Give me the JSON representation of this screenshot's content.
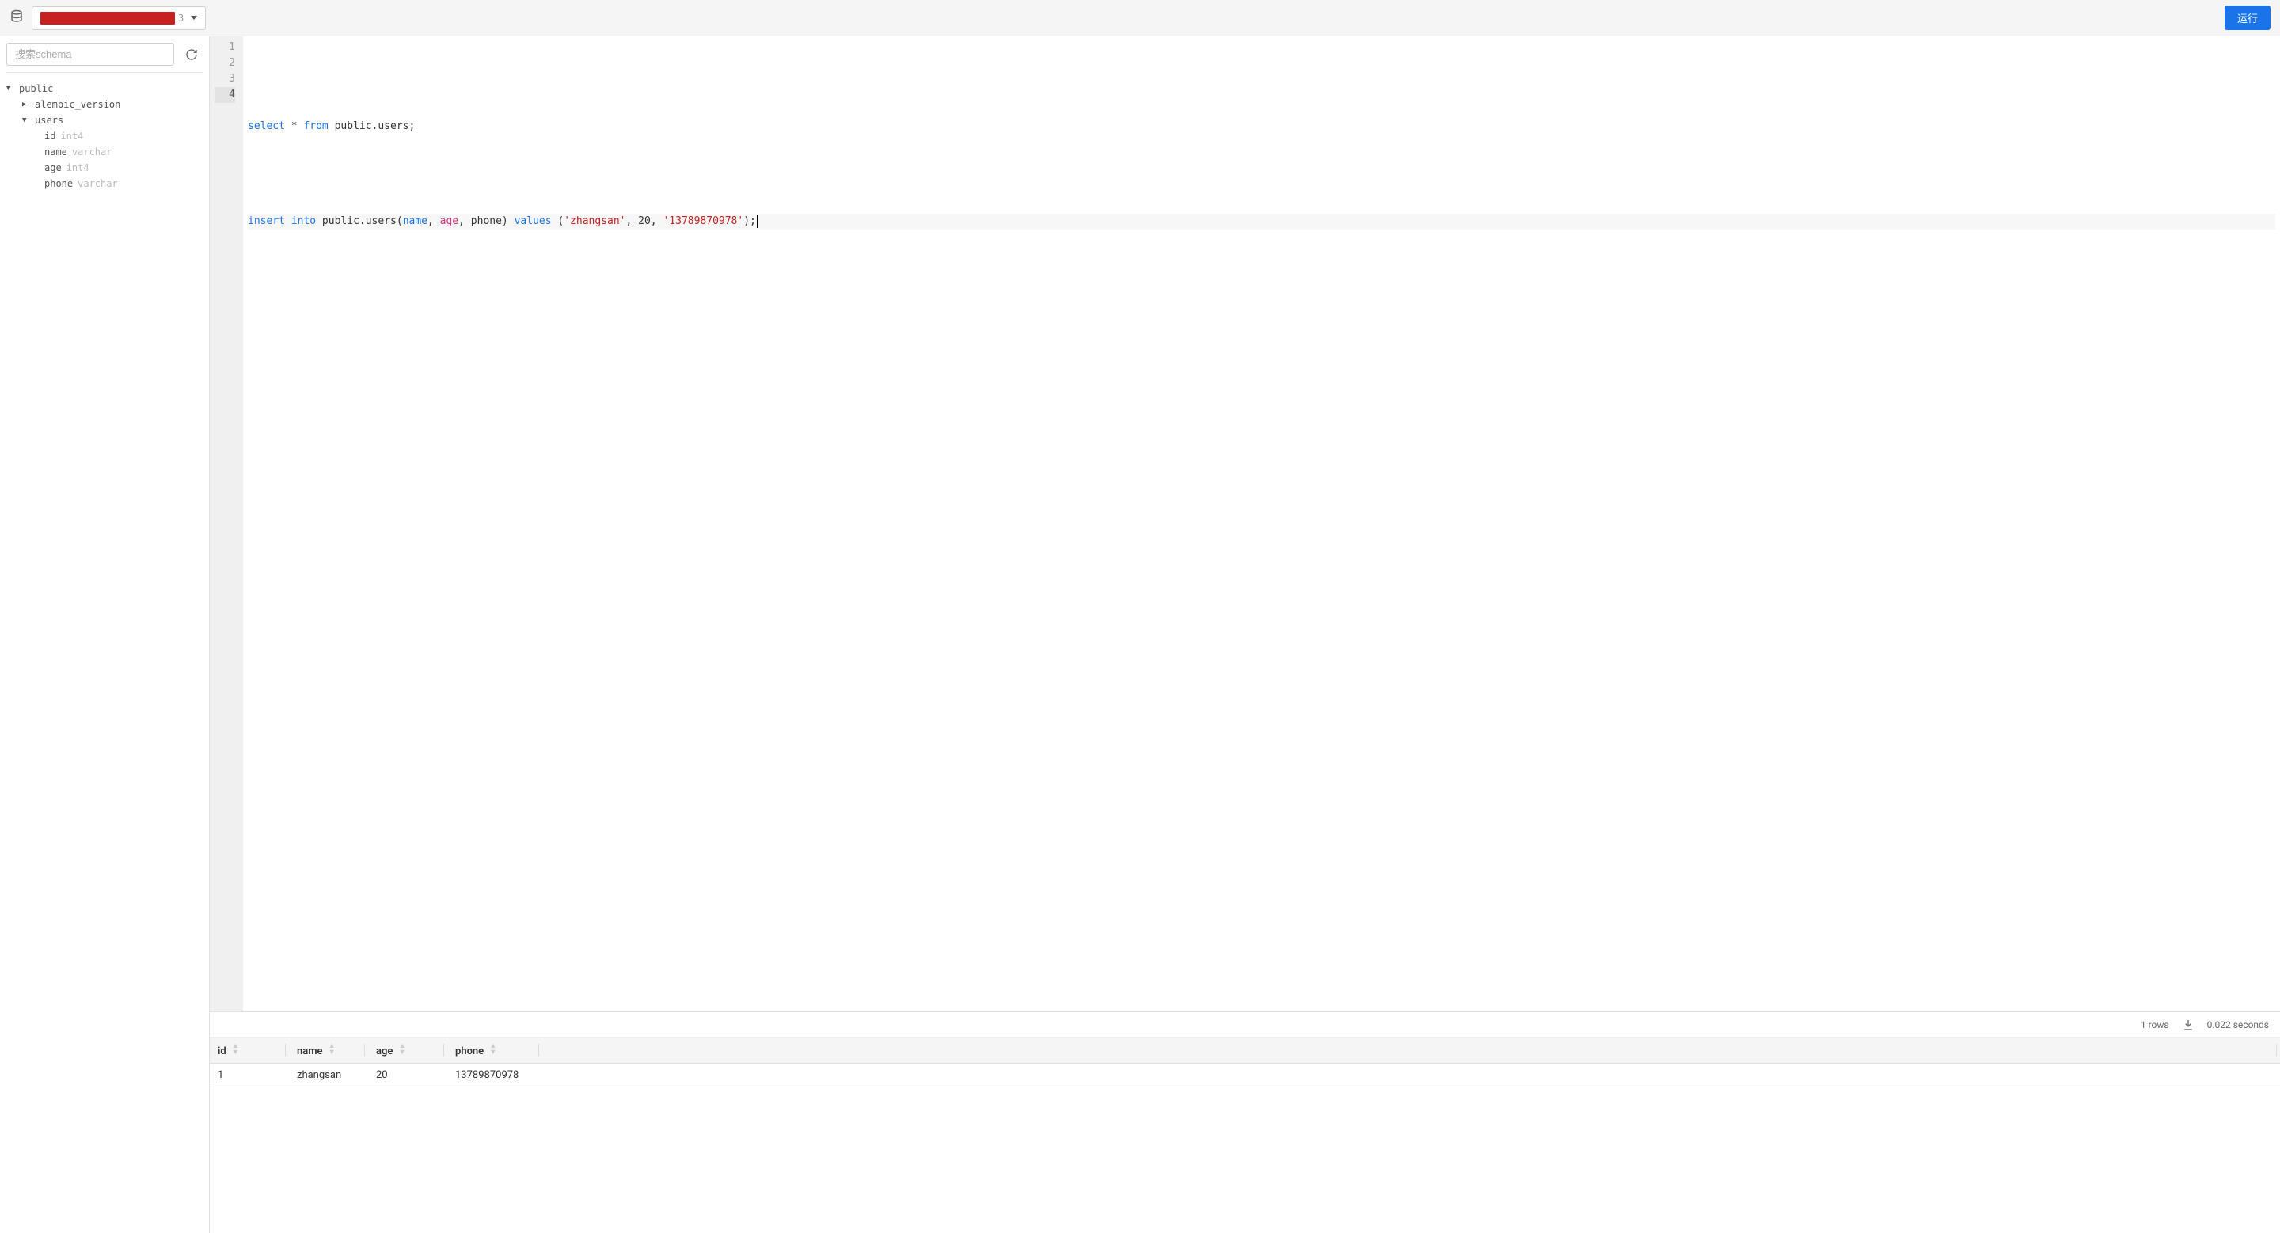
{
  "toolbar": {
    "db_selector_tail": "3",
    "run_label": "运行"
  },
  "sidebar": {
    "search_placeholder": "搜索schema",
    "tree": {
      "schema": "public",
      "tables": [
        {
          "name": "alembic_version",
          "expanded": false
        },
        {
          "name": "users",
          "expanded": true,
          "columns": [
            {
              "name": "id",
              "type": "int4"
            },
            {
              "name": "name",
              "type": "varchar"
            },
            {
              "name": "age",
              "type": "int4"
            },
            {
              "name": "phone",
              "type": "varchar"
            }
          ]
        }
      ]
    }
  },
  "editor": {
    "lines": [
      "",
      "select * from public.users;",
      "",
      "insert into public.users(name, age, phone) values ('zhangsan', 20, '13789870978');"
    ],
    "active_line": 4
  },
  "results": {
    "status_rows": "1 rows",
    "status_time": "0.022 seconds",
    "columns": [
      "id",
      "name",
      "age",
      "phone"
    ],
    "rows": [
      {
        "id": "1",
        "name": "zhangsan",
        "age": "20",
        "phone": "13789870978"
      }
    ]
  }
}
